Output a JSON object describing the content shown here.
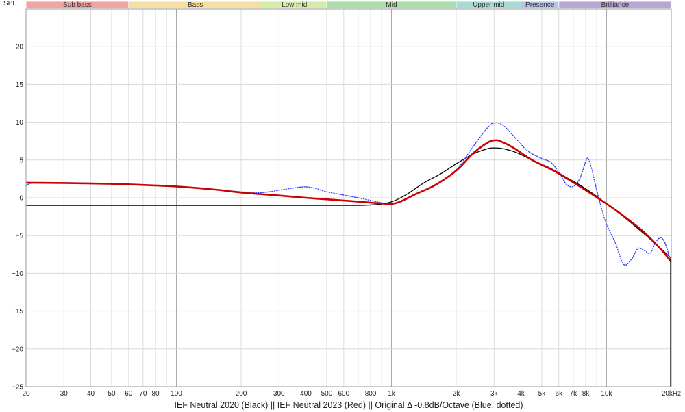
{
  "chart_data": {
    "type": "line",
    "ylabel": "SPL",
    "caption": "IEF Neutral 2020 (Black) || IEF Neutral 2023 (Red) || Original Δ -0.8dB/Octave (Blue, dotted)",
    "x_scale": "log",
    "xlim": [
      20,
      20000
    ],
    "ylim": [
      -25,
      25
    ],
    "grid": true,
    "y_ticks": [
      20,
      15,
      10,
      5,
      0,
      -5,
      -10,
      -15,
      -20,
      -25
    ],
    "y_tick_labels": [
      "20",
      "15",
      "10",
      "5",
      "0",
      "−5",
      "−10",
      "−15",
      "−20",
      "−25"
    ],
    "x_ticks": [
      {
        "value": 20,
        "label": "20"
      },
      {
        "value": 30,
        "label": "30"
      },
      {
        "value": 40,
        "label": "40"
      },
      {
        "value": 50,
        "label": "50"
      },
      {
        "value": 60,
        "label": "60"
      },
      {
        "value": 70,
        "label": "70"
      },
      {
        "value": 80,
        "label": "80"
      },
      {
        "value": 100,
        "label": "100"
      },
      {
        "value": 200,
        "label": "200"
      },
      {
        "value": 300,
        "label": "300"
      },
      {
        "value": 400,
        "label": "400"
      },
      {
        "value": 500,
        "label": "500"
      },
      {
        "value": 600,
        "label": "600"
      },
      {
        "value": 800,
        "label": "800"
      },
      {
        "value": 1000,
        "label": "1k"
      },
      {
        "value": 2000,
        "label": "2k"
      },
      {
        "value": 3000,
        "label": "3k"
      },
      {
        "value": 4000,
        "label": "4k"
      },
      {
        "value": 5000,
        "label": "5k"
      },
      {
        "value": 6000,
        "label": "6k"
      },
      {
        "value": 7000,
        "label": "7k"
      },
      {
        "value": 8000,
        "label": "8k"
      },
      {
        "value": 10000,
        "label": "10k"
      },
      {
        "value": 20000,
        "label": "20kHz"
      }
    ],
    "bands": [
      {
        "label": "Sub bass",
        "from": 20,
        "to": 60,
        "color": "#f4a3a3"
      },
      {
        "label": "Bass",
        "from": 60,
        "to": 250,
        "color": "#f7dfa0"
      },
      {
        "label": "Low mid",
        "from": 250,
        "to": 500,
        "color": "#d4eda6"
      },
      {
        "label": "Mid",
        "from": 500,
        "to": 2000,
        "color": "#a8dfa8"
      },
      {
        "label": "Upper mid",
        "from": 2000,
        "to": 4000,
        "color": "#a6dcd6"
      },
      {
        "label": "Presence",
        "from": 4000,
        "to": 6000,
        "color": "#b3c6ec"
      },
      {
        "label": "Brilliance",
        "from": 6000,
        "to": 20000,
        "color": "#b9a6d6"
      }
    ],
    "series": [
      {
        "color": "#000000",
        "style": "solid",
        "points": [
          [
            20,
            -1.0
          ],
          [
            50,
            -1.0
          ],
          [
            100,
            -1.0
          ],
          [
            200,
            -1.0
          ],
          [
            500,
            -1.0
          ],
          [
            700,
            -1.0
          ],
          [
            850,
            -0.9
          ],
          [
            950,
            -0.7
          ],
          [
            1050,
            -0.3
          ],
          [
            1200,
            0.6
          ],
          [
            1400,
            1.9
          ],
          [
            1700,
            3.2
          ],
          [
            2000,
            4.5
          ],
          [
            2400,
            5.8
          ],
          [
            2800,
            6.5
          ],
          [
            3000,
            6.6
          ],
          [
            3300,
            6.5
          ],
          [
            3800,
            6.0
          ],
          [
            4500,
            5.0
          ],
          [
            5500,
            3.9
          ],
          [
            6500,
            2.7
          ],
          [
            7500,
            1.7
          ],
          [
            9000,
            0.2
          ],
          [
            10000,
            -0.8
          ],
          [
            12000,
            -2.5
          ],
          [
            15000,
            -4.8
          ],
          [
            18000,
            -6.8
          ],
          [
            20000,
            -8.0
          ]
        ]
      },
      {
        "color": "#cc0000",
        "style": "solid",
        "points": [
          [
            20,
            2.0
          ],
          [
            30,
            1.95
          ],
          [
            50,
            1.85
          ],
          [
            70,
            1.7
          ],
          [
            100,
            1.5
          ],
          [
            150,
            1.1
          ],
          [
            200,
            0.7
          ],
          [
            300,
            0.3
          ],
          [
            400,
            0.0
          ],
          [
            500,
            -0.2
          ],
          [
            700,
            -0.5
          ],
          [
            900,
            -0.75
          ],
          [
            1000,
            -0.8
          ],
          [
            1100,
            -0.5
          ],
          [
            1300,
            0.5
          ],
          [
            1600,
            1.7
          ],
          [
            2000,
            3.6
          ],
          [
            2400,
            5.9
          ],
          [
            2800,
            7.3
          ],
          [
            3000,
            7.6
          ],
          [
            3200,
            7.5
          ],
          [
            3700,
            6.6
          ],
          [
            4500,
            5.0
          ],
          [
            5500,
            3.8
          ],
          [
            6500,
            2.6
          ],
          [
            8000,
            1.0
          ],
          [
            10000,
            -0.8
          ],
          [
            12000,
            -2.4
          ],
          [
            15000,
            -4.6
          ],
          [
            18000,
            -6.9
          ],
          [
            20000,
            -8.5
          ]
        ]
      },
      {
        "color": "#3344ff",
        "style": "dotted",
        "points": [
          [
            20,
            1.6
          ],
          [
            22,
            2.0
          ],
          [
            30,
            2.0
          ],
          [
            50,
            1.85
          ],
          [
            70,
            1.7
          ],
          [
            100,
            1.5
          ],
          [
            150,
            1.1
          ],
          [
            200,
            0.8
          ],
          [
            250,
            0.7
          ],
          [
            300,
            1.0
          ],
          [
            350,
            1.3
          ],
          [
            400,
            1.45
          ],
          [
            450,
            1.2
          ],
          [
            500,
            0.8
          ],
          [
            700,
            0.0
          ],
          [
            900,
            -0.65
          ],
          [
            1000,
            -0.8
          ],
          [
            1100,
            -0.5
          ],
          [
            1300,
            0.5
          ],
          [
            1600,
            1.7
          ],
          [
            2000,
            3.7
          ],
          [
            2400,
            6.8
          ],
          [
            2800,
            9.3
          ],
          [
            3000,
            9.9
          ],
          [
            3300,
            9.6
          ],
          [
            3800,
            7.8
          ],
          [
            4300,
            6.2
          ],
          [
            5000,
            5.2
          ],
          [
            5500,
            4.7
          ],
          [
            6000,
            3.4
          ],
          [
            6500,
            1.8
          ],
          [
            7000,
            1.5
          ],
          [
            7500,
            2.5
          ],
          [
            8000,
            4.8
          ],
          [
            8200,
            5.2
          ],
          [
            8500,
            4.0
          ],
          [
            9000,
            1.0
          ],
          [
            9500,
            -1.5
          ],
          [
            10000,
            -3.5
          ],
          [
            11000,
            -6.0
          ],
          [
            12000,
            -8.8
          ],
          [
            13000,
            -8.2
          ],
          [
            14000,
            -6.7
          ],
          [
            15000,
            -7.0
          ],
          [
            16000,
            -7.3
          ],
          [
            17000,
            -5.8
          ],
          [
            18000,
            -5.3
          ],
          [
            19000,
            -6.5
          ],
          [
            20000,
            -9.0
          ]
        ]
      }
    ]
  }
}
